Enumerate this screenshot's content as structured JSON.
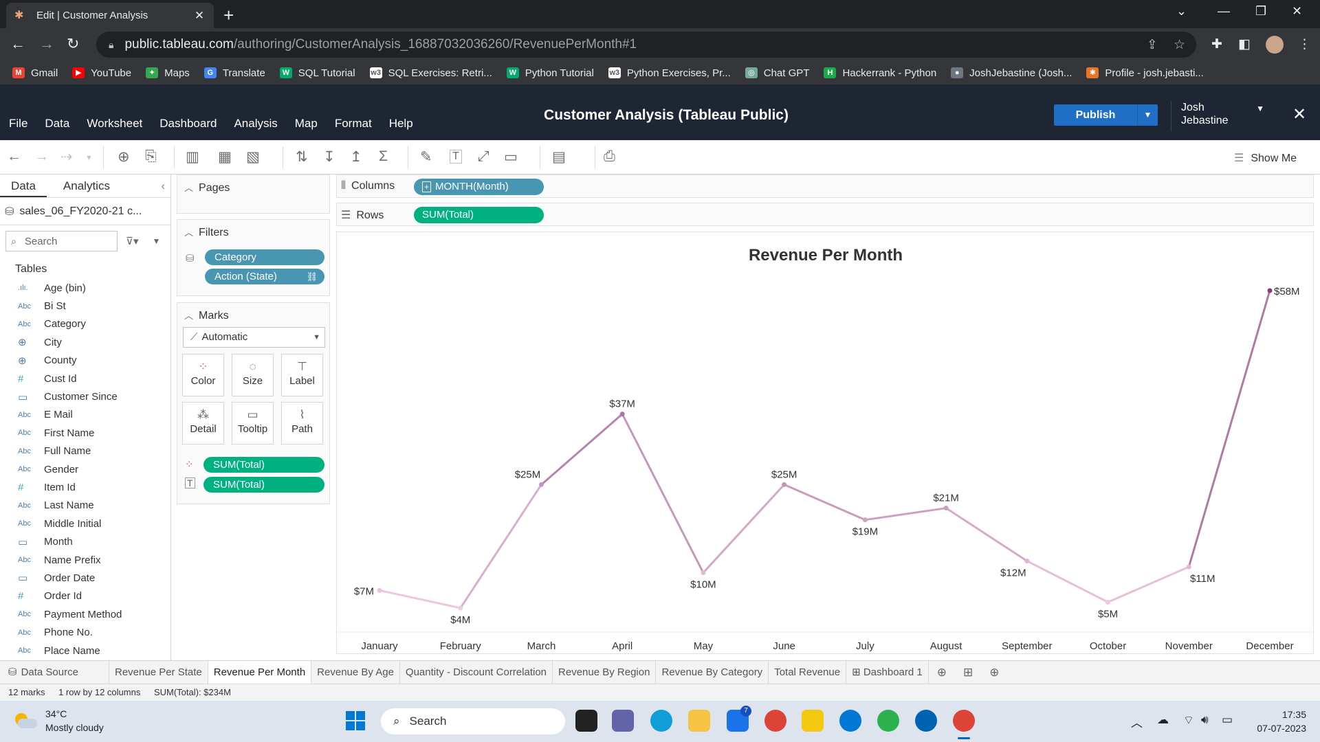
{
  "browser": {
    "tab_title": "Edit | Customer Analysis",
    "url_host": "public.tableau.com",
    "url_path": "/authoring/CustomerAnalysis_16887032036260/RevenuePerMonth#1",
    "bookmarks": [
      {
        "label": "Gmail",
        "color": "#ea4335",
        "glyph": "M"
      },
      {
        "label": "YouTube",
        "color": "#ff0000",
        "glyph": "▶"
      },
      {
        "label": "Maps",
        "color": "#34a853",
        "glyph": "✦"
      },
      {
        "label": "Translate",
        "color": "#4285f4",
        "glyph": "G"
      },
      {
        "label": "SQL Tutorial",
        "color": "#04aa6d",
        "glyph": "W"
      },
      {
        "label": "SQL Exercises: Retri...",
        "color": "#ffffff",
        "glyph": "w3"
      },
      {
        "label": "Python Tutorial",
        "color": "#04aa6d",
        "glyph": "W"
      },
      {
        "label": "Python Exercises, Pr...",
        "color": "#ffffff",
        "glyph": "w3"
      },
      {
        "label": "Chat GPT",
        "color": "#74aa9c",
        "glyph": "◎"
      },
      {
        "label": "Hackerrank - Python",
        "color": "#1ba94c",
        "glyph": "H"
      },
      {
        "label": "JoshJebastine (Josh...",
        "color": "#6e7681",
        "glyph": "●"
      },
      {
        "label": "Profile - josh.jebasti...",
        "color": "#e97627",
        "glyph": "✱"
      }
    ]
  },
  "tableau": {
    "menu": [
      "File",
      "Data",
      "Worksheet",
      "Dashboard",
      "Analysis",
      "Map",
      "Format",
      "Help"
    ],
    "app_title": "Customer Analysis (Tableau Public)",
    "publish_label": "Publish",
    "user_first": "Josh",
    "user_last": "Jebastine",
    "show_me": "Show Me"
  },
  "datapane": {
    "tab_data": "Data",
    "tab_analytics": "Analytics",
    "source": "sales_06_FY2020-21 c...",
    "search_placeholder": "Search",
    "tables_heading": "Tables",
    "fields": [
      {
        "type": "bin",
        "type_label": ".ılı.",
        "name": "Age (bin)"
      },
      {
        "type": "abc",
        "type_label": "Abc",
        "name": "Bi St"
      },
      {
        "type": "abc",
        "type_label": "Abc",
        "name": "Category"
      },
      {
        "type": "geo",
        "type_label": "⊕",
        "name": "City"
      },
      {
        "type": "geo",
        "type_label": "⊕",
        "name": "County"
      },
      {
        "type": "num",
        "type_label": "#",
        "name": "Cust Id"
      },
      {
        "type": "date",
        "type_label": "▭",
        "name": "Customer Since"
      },
      {
        "type": "abc",
        "type_label": "Abc",
        "name": "E Mail"
      },
      {
        "type": "abc",
        "type_label": "Abc",
        "name": "First Name"
      },
      {
        "type": "abc",
        "type_label": "Abc",
        "name": "Full Name"
      },
      {
        "type": "abc",
        "type_label": "Abc",
        "name": "Gender"
      },
      {
        "type": "num",
        "type_label": "#",
        "name": "Item Id"
      },
      {
        "type": "abc",
        "type_label": "Abc",
        "name": "Last Name"
      },
      {
        "type": "abc",
        "type_label": "Abc",
        "name": "Middle Initial"
      },
      {
        "type": "date",
        "type_label": "▭",
        "name": "Month"
      },
      {
        "type": "abc",
        "type_label": "Abc",
        "name": "Name Prefix"
      },
      {
        "type": "date",
        "type_label": "▭",
        "name": "Order Date"
      },
      {
        "type": "num",
        "type_label": "#",
        "name": "Order Id"
      },
      {
        "type": "abc",
        "type_label": "Abc",
        "name": "Payment Method"
      },
      {
        "type": "abc",
        "type_label": "Abc",
        "name": "Phone No."
      },
      {
        "type": "abc",
        "type_label": "Abc",
        "name": "Place Name"
      }
    ]
  },
  "cards": {
    "pages": "Pages",
    "filters": "Filters",
    "filter_category": "Category",
    "filter_action": "Action (State)",
    "marks": "Marks",
    "mark_type": "Automatic",
    "btn_color": "Color",
    "btn_size": "Size",
    "btn_label": "Label",
    "btn_detail": "Detail",
    "btn_tooltip": "Tooltip",
    "btn_path": "Path",
    "mark_pill_color": "SUM(Total)",
    "mark_pill_label": "SUM(Total)"
  },
  "shelves": {
    "columns_label": "Columns",
    "columns_pill": "MONTH(Month)",
    "rows_label": "Rows",
    "rows_pill": "SUM(Total)"
  },
  "chart_data": {
    "type": "line",
    "title": "Revenue Per Month",
    "categories": [
      "January",
      "February",
      "March",
      "April",
      "May",
      "June",
      "July",
      "August",
      "September",
      "October",
      "November",
      "December"
    ],
    "values": [
      7,
      4,
      25,
      37,
      10,
      25,
      19,
      21,
      12,
      5,
      11,
      58
    ],
    "value_unit": "M",
    "data_labels": [
      "$7M",
      "$4M",
      "$25M",
      "$37M",
      "$10M",
      "$25M",
      "$19M",
      "$21M",
      "$12M",
      "$5M",
      "$11M",
      "$58M"
    ],
    "color_low": "#f0c9e2",
    "color_high": "#7b3f7a",
    "grid": false
  },
  "sheet_tabs": {
    "data_source": "Data Source",
    "tabs": [
      "Revenue Per State",
      "Revenue Per Month",
      "Revenue By Age",
      "Quantity - Discount Correlation",
      "Revenue By Region",
      "Revenue By Category",
      "Total Revenue",
      "Dashboard 1"
    ],
    "active": "Revenue Per Month"
  },
  "status": {
    "marks": "12 marks",
    "dims": "1 row by 12 columns",
    "sum": "SUM(Total): $234M"
  },
  "taskbar": {
    "temp": "34°C",
    "weather": "Mostly cloudy",
    "search": "Search",
    "time": "17:35",
    "date": "07-07-2023",
    "mail_badge": "7"
  }
}
